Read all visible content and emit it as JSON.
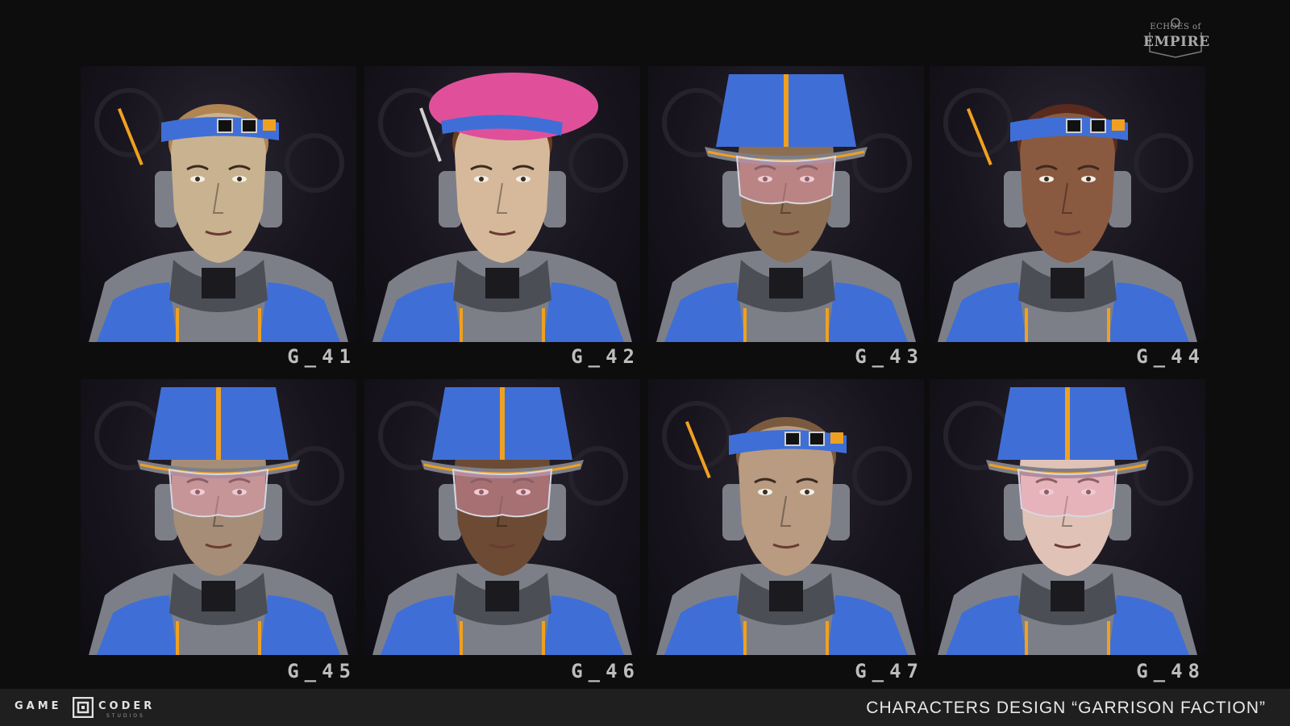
{
  "logo": {
    "top_text": "ECHOES of",
    "main_text": "EMPIRE"
  },
  "portraits": [
    {
      "label": "G_41",
      "headwear": "goggle-headband",
      "skin": "#c9b28f",
      "hair": "#b08552"
    },
    {
      "label": "G_42",
      "headwear": "pink-beret",
      "skin": "#d6b99b",
      "hair": "#6a3c22"
    },
    {
      "label": "G_43",
      "headwear": "bucket-helmet-visor",
      "skin": "#8c6e53",
      "hair": "none"
    },
    {
      "label": "G_44",
      "headwear": "goggle-headband",
      "skin": "#8a5a40",
      "hair": "#5a2a1e"
    },
    {
      "label": "G_45",
      "headwear": "bucket-helmet-visor",
      "skin": "#a58d77",
      "hair": "none"
    },
    {
      "label": "G_46",
      "headwear": "bucket-helmet-visor",
      "skin": "#6c4a34",
      "hair": "none"
    },
    {
      "label": "G_47",
      "headwear": "goggle-headband",
      "skin": "#b89b80",
      "hair": "#7a5a3e"
    },
    {
      "label": "G_48",
      "headwear": "bucket-helmet-visor",
      "skin": "#e0c3b6",
      "hair": "none"
    }
  ],
  "footer": {
    "studio_word1": "GAME",
    "studio_word2": "CODER",
    "studio_sub": "STUDIOS",
    "title": "CHARACTERS DESIGN “GARRISON FACTION”"
  },
  "colors": {
    "armor_blue": "#3f6fd6",
    "armor_gray": "#7d7f88",
    "accent_orange": "#f0a020",
    "beret_pink": "#e0509a",
    "background": "#0d0d0d",
    "footer_bar": "#1f1f1f"
  }
}
